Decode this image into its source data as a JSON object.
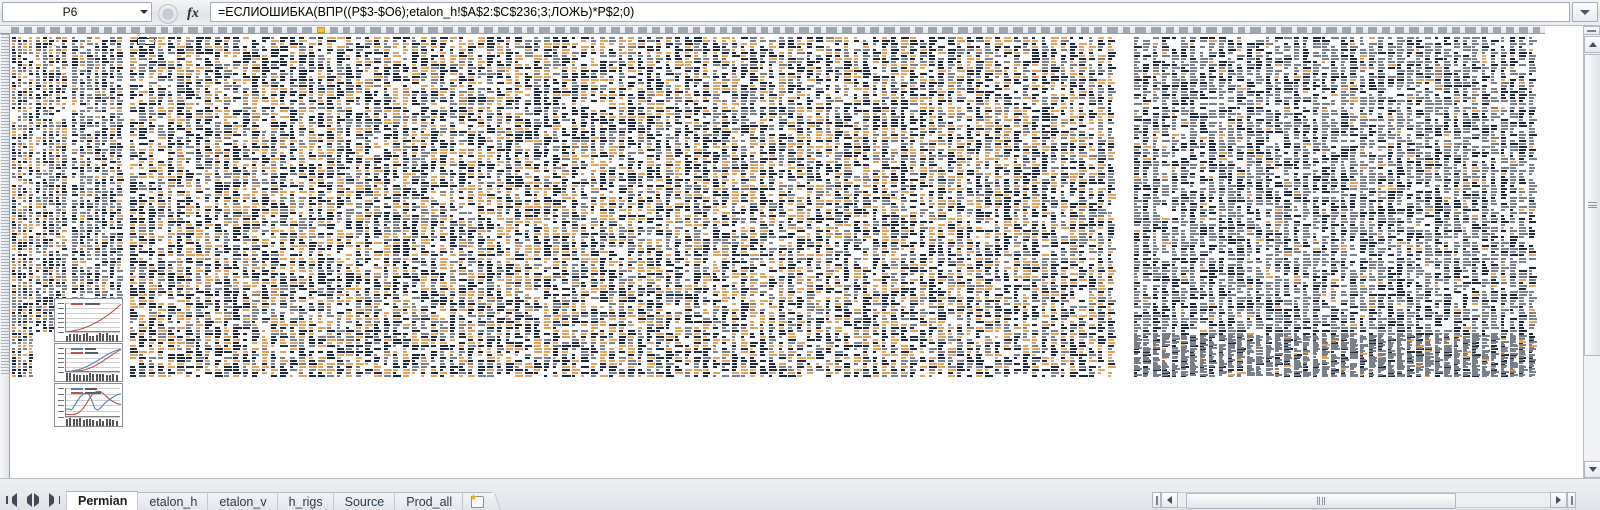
{
  "application": {
    "type": "spreadsheet",
    "locale": "ru"
  },
  "formula_bar": {
    "name_box": {
      "value": "P6",
      "placeholder": "P6",
      "dropdown_icon": "chevron-down-icon"
    },
    "cancel_button_icon": "cancel-icon",
    "enter_button_icon": "enter-icon",
    "insert_function_label": "fx",
    "formula": "=ЕСЛИОШИБКА(ВПР((P$3-$O6);etalon_h!$A$2:$C$236;3;ЛОЖЬ)*P$2;0)",
    "expand_icon": "chevron-down-icon"
  },
  "grid": {
    "active_cell": "P6",
    "selected_column": "P",
    "zoom_note": "zoomed-out-view",
    "colors": {
      "text_dark": "#1f2b3d",
      "text_orange": "#e0a45e",
      "text_gray": "#7a808a",
      "header": "#9fa6b0",
      "selection": "#f0c33c"
    }
  },
  "charts": [
    {
      "name": "chart-cumulative-wells",
      "type": "line",
      "title": "",
      "xlabel": "",
      "ylabel": "",
      "gridlines": 6,
      "legend_position": "top-left",
      "legend": [
        "Series 1",
        "Series 2"
      ],
      "series": [
        {
          "name": "Series 1",
          "color": "#c0504d",
          "values": [
            2,
            4,
            7,
            11,
            16,
            22,
            29,
            37,
            46,
            56,
            67,
            79,
            92,
            106,
            121,
            137,
            154,
            172,
            191,
            211
          ]
        }
      ],
      "ylim": [
        0,
        220
      ]
    },
    {
      "name": "chart-production-forecast",
      "type": "line",
      "title": "",
      "xlabel": "",
      "ylabel": "",
      "gridlines": 5,
      "legend_position": "top-left",
      "legend": [
        "Series 1",
        "Series 2"
      ],
      "series": [
        {
          "name": "Series 1",
          "color": "#4f81bd",
          "values": [
            3,
            5,
            8,
            13,
            19,
            27,
            37,
            48,
            61,
            75,
            90,
            106,
            122,
            139,
            155,
            170,
            183,
            194,
            203,
            210
          ]
        },
        {
          "name": "Series 2",
          "color": "#c0504d",
          "values": [
            1,
            2,
            3,
            5,
            8,
            12,
            17,
            24,
            33,
            44,
            57,
            72,
            88,
            105,
            123,
            141,
            159,
            176,
            192,
            206
          ]
        }
      ],
      "ylim": [
        0,
        220
      ]
    },
    {
      "name": "chart-rigs-vs-production",
      "type": "line",
      "title": "",
      "xlabel": "",
      "ylabel": "",
      "gridlines": 5,
      "legend_position": "top-left",
      "legend": [
        "Series 1",
        "Series 2"
      ],
      "series": [
        {
          "name": "Series 1",
          "color": "#4f81bd",
          "values": [
            30,
            30,
            28,
            45,
            62,
            78,
            88,
            92,
            86,
            60,
            32,
            26,
            35,
            48,
            58,
            66,
            74,
            80,
            85,
            88
          ]
        },
        {
          "name": "Series 2",
          "color": "#c0504d",
          "values": [
            10,
            9,
            9,
            10,
            14,
            22,
            34,
            50,
            68,
            84,
            94,
            98,
            96,
            88,
            78,
            68,
            60,
            54,
            50,
            47
          ]
        }
      ],
      "ylim": [
        0,
        110
      ]
    }
  ],
  "sheet_tabs": {
    "navigation": {
      "first_icon": "first-sheet-icon",
      "previous_icon": "previous-sheet-icon",
      "next_icon": "next-sheet-icon",
      "last_icon": "last-sheet-icon"
    },
    "tabs": [
      {
        "label": "Permian",
        "active": true
      },
      {
        "label": "etalon_h",
        "active": false
      },
      {
        "label": "etalon_v",
        "active": false
      },
      {
        "label": "h_rigs",
        "active": false
      },
      {
        "label": "Source",
        "active": false
      },
      {
        "label": "Prod_all",
        "active": false
      }
    ],
    "insert_sheet_icon": "insert-worksheet-icon"
  },
  "scrollbars": {
    "vertical": {
      "split_icon": "split-handle-icon",
      "up_icon": "scroll-up-icon",
      "down_icon": "scroll-down-icon",
      "thumb_grip_icon": "grip-icon"
    },
    "horizontal": {
      "split_icon": "split-handle-icon",
      "left_icon": "scroll-left-icon",
      "right_icon": "scroll-right-icon",
      "thumb_grip_icon": "grip-icon"
    }
  }
}
